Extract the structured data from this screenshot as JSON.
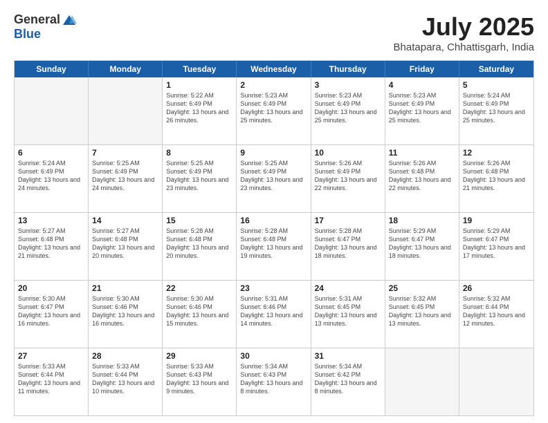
{
  "logo": {
    "general": "General",
    "blue": "Blue"
  },
  "title": "July 2025",
  "location": "Bhatapara, Chhattisgarh, India",
  "weekdays": [
    "Sunday",
    "Monday",
    "Tuesday",
    "Wednesday",
    "Thursday",
    "Friday",
    "Saturday"
  ],
  "weeks": [
    [
      {
        "day": "",
        "info": "",
        "empty": true
      },
      {
        "day": "",
        "info": "",
        "empty": true
      },
      {
        "day": "1",
        "info": "Sunrise: 5:22 AM\nSunset: 6:49 PM\nDaylight: 13 hours and 26 minutes."
      },
      {
        "day": "2",
        "info": "Sunrise: 5:23 AM\nSunset: 6:49 PM\nDaylight: 13 hours and 25 minutes."
      },
      {
        "day": "3",
        "info": "Sunrise: 5:23 AM\nSunset: 6:49 PM\nDaylight: 13 hours and 25 minutes."
      },
      {
        "day": "4",
        "info": "Sunrise: 5:23 AM\nSunset: 6:49 PM\nDaylight: 13 hours and 25 minutes."
      },
      {
        "day": "5",
        "info": "Sunrise: 5:24 AM\nSunset: 6:49 PM\nDaylight: 13 hours and 25 minutes."
      }
    ],
    [
      {
        "day": "6",
        "info": "Sunrise: 5:24 AM\nSunset: 6:49 PM\nDaylight: 13 hours and 24 minutes."
      },
      {
        "day": "7",
        "info": "Sunrise: 5:25 AM\nSunset: 6:49 PM\nDaylight: 13 hours and 24 minutes."
      },
      {
        "day": "8",
        "info": "Sunrise: 5:25 AM\nSunset: 6:49 PM\nDaylight: 13 hours and 23 minutes."
      },
      {
        "day": "9",
        "info": "Sunrise: 5:25 AM\nSunset: 6:49 PM\nDaylight: 13 hours and 23 minutes."
      },
      {
        "day": "10",
        "info": "Sunrise: 5:26 AM\nSunset: 6:49 PM\nDaylight: 13 hours and 22 minutes."
      },
      {
        "day": "11",
        "info": "Sunrise: 5:26 AM\nSunset: 6:48 PM\nDaylight: 13 hours and 22 minutes."
      },
      {
        "day": "12",
        "info": "Sunrise: 5:26 AM\nSunset: 6:48 PM\nDaylight: 13 hours and 21 minutes."
      }
    ],
    [
      {
        "day": "13",
        "info": "Sunrise: 5:27 AM\nSunset: 6:48 PM\nDaylight: 13 hours and 21 minutes."
      },
      {
        "day": "14",
        "info": "Sunrise: 5:27 AM\nSunset: 6:48 PM\nDaylight: 13 hours and 20 minutes."
      },
      {
        "day": "15",
        "info": "Sunrise: 5:28 AM\nSunset: 6:48 PM\nDaylight: 13 hours and 20 minutes."
      },
      {
        "day": "16",
        "info": "Sunrise: 5:28 AM\nSunset: 6:48 PM\nDaylight: 13 hours and 19 minutes."
      },
      {
        "day": "17",
        "info": "Sunrise: 5:28 AM\nSunset: 6:47 PM\nDaylight: 13 hours and 18 minutes."
      },
      {
        "day": "18",
        "info": "Sunrise: 5:29 AM\nSunset: 6:47 PM\nDaylight: 13 hours and 18 minutes."
      },
      {
        "day": "19",
        "info": "Sunrise: 5:29 AM\nSunset: 6:47 PM\nDaylight: 13 hours and 17 minutes."
      }
    ],
    [
      {
        "day": "20",
        "info": "Sunrise: 5:30 AM\nSunset: 6:47 PM\nDaylight: 13 hours and 16 minutes."
      },
      {
        "day": "21",
        "info": "Sunrise: 5:30 AM\nSunset: 6:46 PM\nDaylight: 13 hours and 16 minutes."
      },
      {
        "day": "22",
        "info": "Sunrise: 5:30 AM\nSunset: 6:46 PM\nDaylight: 13 hours and 15 minutes."
      },
      {
        "day": "23",
        "info": "Sunrise: 5:31 AM\nSunset: 6:46 PM\nDaylight: 13 hours and 14 minutes."
      },
      {
        "day": "24",
        "info": "Sunrise: 5:31 AM\nSunset: 6:45 PM\nDaylight: 13 hours and 13 minutes."
      },
      {
        "day": "25",
        "info": "Sunrise: 5:32 AM\nSunset: 6:45 PM\nDaylight: 13 hours and 13 minutes."
      },
      {
        "day": "26",
        "info": "Sunrise: 5:32 AM\nSunset: 6:44 PM\nDaylight: 13 hours and 12 minutes."
      }
    ],
    [
      {
        "day": "27",
        "info": "Sunrise: 5:33 AM\nSunset: 6:44 PM\nDaylight: 13 hours and 11 minutes."
      },
      {
        "day": "28",
        "info": "Sunrise: 5:33 AM\nSunset: 6:44 PM\nDaylight: 13 hours and 10 minutes."
      },
      {
        "day": "29",
        "info": "Sunrise: 5:33 AM\nSunset: 6:43 PM\nDaylight: 13 hours and 9 minutes."
      },
      {
        "day": "30",
        "info": "Sunrise: 5:34 AM\nSunset: 6:43 PM\nDaylight: 13 hours and 8 minutes."
      },
      {
        "day": "31",
        "info": "Sunrise: 5:34 AM\nSunset: 6:42 PM\nDaylight: 13 hours and 8 minutes."
      },
      {
        "day": "",
        "info": "",
        "empty": true
      },
      {
        "day": "",
        "info": "",
        "empty": true
      }
    ]
  ]
}
